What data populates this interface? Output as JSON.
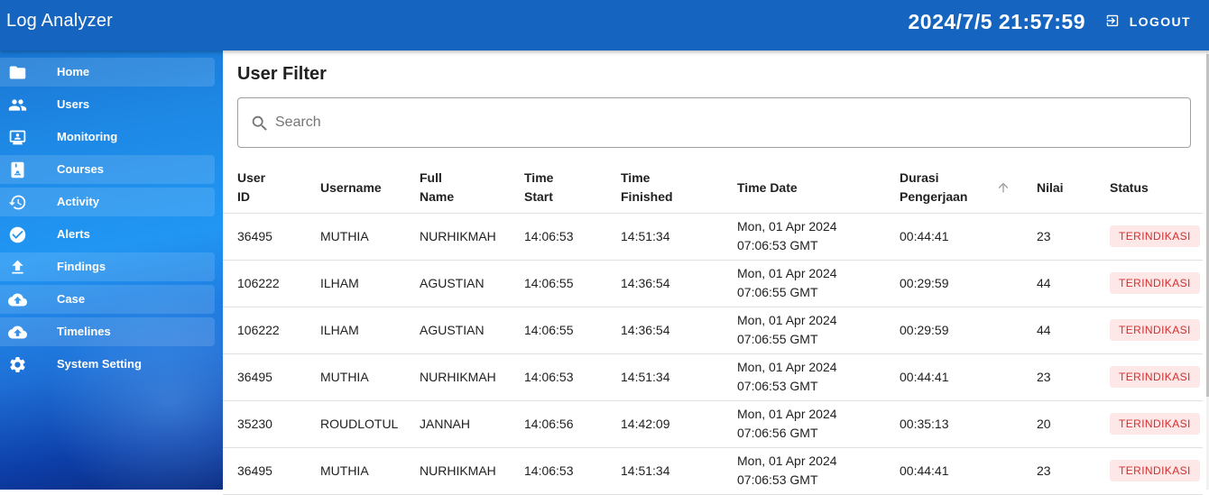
{
  "header": {
    "title": "Log Analyzer",
    "clock": "2024/7/5 21:57:59",
    "logout_label": "LOGOUT"
  },
  "sidebar": {
    "items": [
      {
        "label": "Home",
        "icon": "folder-icon"
      },
      {
        "label": "Users",
        "icon": "users-icon"
      },
      {
        "label": "Monitoring",
        "icon": "monitor-icon"
      },
      {
        "label": "Courses",
        "icon": "book-icon"
      },
      {
        "label": "Activity",
        "icon": "history-icon"
      },
      {
        "label": "Alerts",
        "icon": "check-circle-icon"
      },
      {
        "label": "Findings",
        "icon": "upload-icon"
      },
      {
        "label": "Case",
        "icon": "cloud-upload-icon"
      },
      {
        "label": "Timelines",
        "icon": "cloud-upload-icon"
      },
      {
        "label": "System Setting",
        "icon": "gear-icon"
      }
    ]
  },
  "main": {
    "title": "User Filter",
    "search_placeholder": "Search",
    "columns": [
      "User ID",
      "Username",
      "Full Name",
      "Time Start",
      "Time Finished",
      "Time Date",
      "Durasi Pengerjaan",
      "Nilai",
      "Status"
    ],
    "rows": [
      {
        "user_id": "36495",
        "username": "MUTHIA",
        "full_name": "NURHIKMAH",
        "time_start": "14:06:53",
        "time_finished": "14:51:34",
        "date_line1": "Mon, 01 Apr 2024",
        "date_line2": "07:06:53 GMT",
        "durasi": "00:44:41",
        "nilai": "23",
        "status": "TERINDIKASI"
      },
      {
        "user_id": "106222",
        "username": "ILHAM",
        "full_name": "AGUSTIAN",
        "time_start": "14:06:55",
        "time_finished": "14:36:54",
        "date_line1": "Mon, 01 Apr 2024",
        "date_line2": "07:06:55 GMT",
        "durasi": "00:29:59",
        "nilai": "44",
        "status": "TERINDIKASI"
      },
      {
        "user_id": "106222",
        "username": "ILHAM",
        "full_name": "AGUSTIAN",
        "time_start": "14:06:55",
        "time_finished": "14:36:54",
        "date_line1": "Mon, 01 Apr 2024",
        "date_line2": "07:06:55 GMT",
        "durasi": "00:29:59",
        "nilai": "44",
        "status": "TERINDIKASI"
      },
      {
        "user_id": "36495",
        "username": "MUTHIA",
        "full_name": "NURHIKMAH",
        "time_start": "14:06:53",
        "time_finished": "14:51:34",
        "date_line1": "Mon, 01 Apr 2024",
        "date_line2": "07:06:53 GMT",
        "durasi": "00:44:41",
        "nilai": "23",
        "status": "TERINDIKASI"
      },
      {
        "user_id": "35230",
        "username": "ROUDLOTUL",
        "full_name": "JANNAH",
        "time_start": "14:06:56",
        "time_finished": "14:42:09",
        "date_line1": "Mon, 01 Apr 2024",
        "date_line2": "07:06:56 GMT",
        "durasi": "00:35:13",
        "nilai": "20",
        "status": "TERINDIKASI"
      },
      {
        "user_id": "36495",
        "username": "MUTHIA",
        "full_name": "NURHIKMAH",
        "time_start": "14:06:53",
        "time_finished": "14:51:34",
        "date_line1": "Mon, 01 Apr 2024",
        "date_line2": "07:06:53 GMT",
        "durasi": "00:44:41",
        "nilai": "23",
        "status": "TERINDIKASI"
      }
    ]
  },
  "colors": {
    "appbar": "#1565c0",
    "status_badge_bg": "#fde7e7",
    "status_badge_text": "#d32f2f"
  }
}
